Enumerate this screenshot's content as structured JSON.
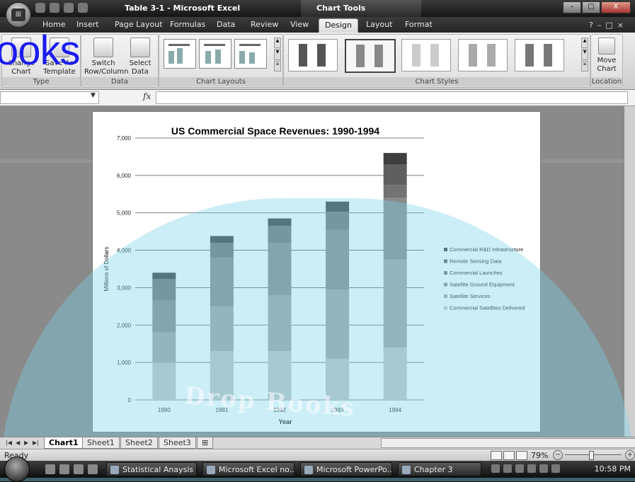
{
  "titlebar": {
    "title": "Table 3-1 - Microsoft Excel",
    "contextual_tab": "Chart Tools",
    "min": "–",
    "max": "□",
    "close": "X"
  },
  "tabs": [
    "Home",
    "Insert",
    "Page Layout",
    "Formulas",
    "Data",
    "Review",
    "View",
    "Design",
    "Layout",
    "Format"
  ],
  "active_tab": "Design",
  "ribbon": {
    "type_group": {
      "label": "Type",
      "change_chart_type": "Change Chart Type",
      "save_as_template": "Save As Template"
    },
    "data_group": {
      "label": "Data",
      "switch": "Switch Row/Column",
      "select": "Select Data"
    },
    "layouts_group": {
      "label": "Chart Layouts"
    },
    "styles_group": {
      "label": "Chart Styles"
    },
    "location_group": {
      "label": "Location",
      "move": "Move Chart"
    }
  },
  "formula_bar": {
    "fx": "fx",
    "name_box": "",
    "formula": ""
  },
  "watermark": {
    "books_text": "ooks",
    "drop_text": "Drop Books"
  },
  "chart_data": {
    "type": "bar",
    "stacked": true,
    "title": "US Commercial Space Revenues: 1990-1994",
    "xlabel": "Year",
    "ylabel": "Millions of Dollars",
    "ylim": [
      0,
      7000
    ],
    "yticks": [
      0,
      1000,
      2000,
      3000,
      4000,
      5000,
      6000,
      7000
    ],
    "ytick_labels": [
      "0",
      "1,000",
      "2,000",
      "3,000",
      "4,000",
      "5,000",
      "6,000",
      "7,000"
    ],
    "grid": true,
    "legend_position": "right",
    "categories": [
      "1990",
      "1991",
      "1992",
      "1993",
      "1994"
    ],
    "series": [
      {
        "name": "Commercial Satellites Delivered",
        "values": [
          1000,
          1300,
          1300,
          1100,
          1400
        ],
        "color": "#c4c4c4"
      },
      {
        "name": "Satellite Services",
        "values": [
          800,
          1200,
          1500,
          1850,
          2350
        ],
        "color": "#a3a3a3"
      },
      {
        "name": "Satellite Ground Equipment",
        "values": [
          860,
          1300,
          1400,
          1600,
          1650
        ],
        "color": "#8a8a8a"
      },
      {
        "name": "Commercial Launches",
        "values": [
          570,
          400,
          450,
          480,
          350
        ],
        "color": "#737373"
      },
      {
        "name": "Remote Sensing Data",
        "values": [
          0,
          0,
          0,
          0,
          550
        ],
        "color": "#5f5f5f"
      },
      {
        "name": "Commercial R&D Infrastructure",
        "values": [
          170,
          180,
          200,
          270,
          300
        ],
        "color": "#3e3e3e"
      }
    ]
  },
  "sheets": [
    "Chart1",
    "Sheet1",
    "Sheet2",
    "Sheet3"
  ],
  "active_sheet": "Chart1",
  "status": {
    "text": "Ready",
    "zoom": "79%"
  },
  "taskbar": {
    "tasks": [
      "Statistical Anaysis ...",
      "Microsoft Excel no...",
      "Microsoft PowerPo...",
      "Chapter 3"
    ],
    "clock": "10:58 PM"
  }
}
